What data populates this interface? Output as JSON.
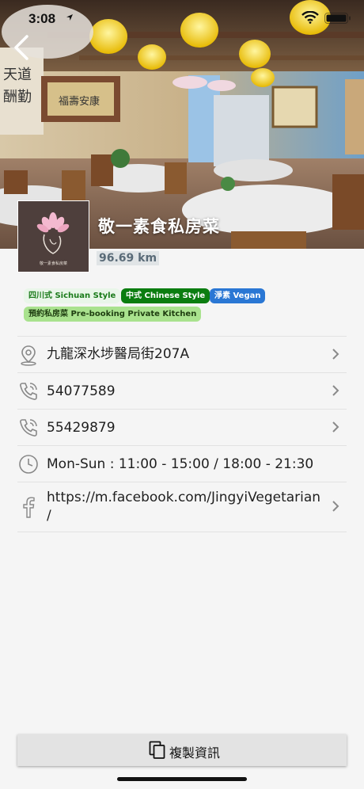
{
  "status_bar": {
    "time": "3:08"
  },
  "restaurant": {
    "name": "敬一素食私房菜",
    "distance": "96.69 km",
    "logo_text": "敬一素食私房菜"
  },
  "tags": [
    {
      "label": "四川式 Sichuan Style"
    },
    {
      "label": "中式 Chinese Style"
    },
    {
      "label": "淨素 Vegan"
    },
    {
      "label": "預約私房菜 Pre-booking Private Kitchen"
    }
  ],
  "info_rows": [
    {
      "icon": "location-pin-icon",
      "text": "九龍深水埗醫局街207A"
    },
    {
      "icon": "phone-icon",
      "text": "54077589"
    },
    {
      "icon": "phone-icon",
      "text": "55429879"
    },
    {
      "icon": "clock-icon",
      "text": "Mon-Sun : 11:00 - 15:00 / 18:00 - 21:30"
    },
    {
      "icon": "facebook-icon",
      "text_line1": "https://m.facebook.com/JingyiVegetarian",
      "text_line2": "/"
    }
  ],
  "copy_button": {
    "label": "複製資訊",
    "icon": "copy-icon"
  },
  "colors": {
    "tag_chinese": "#0b7d10",
    "tag_vegan": "#2a77d4",
    "tag_prebooking": "#a9e28e",
    "tag_sichuan_text": "#1a7a1a"
  }
}
